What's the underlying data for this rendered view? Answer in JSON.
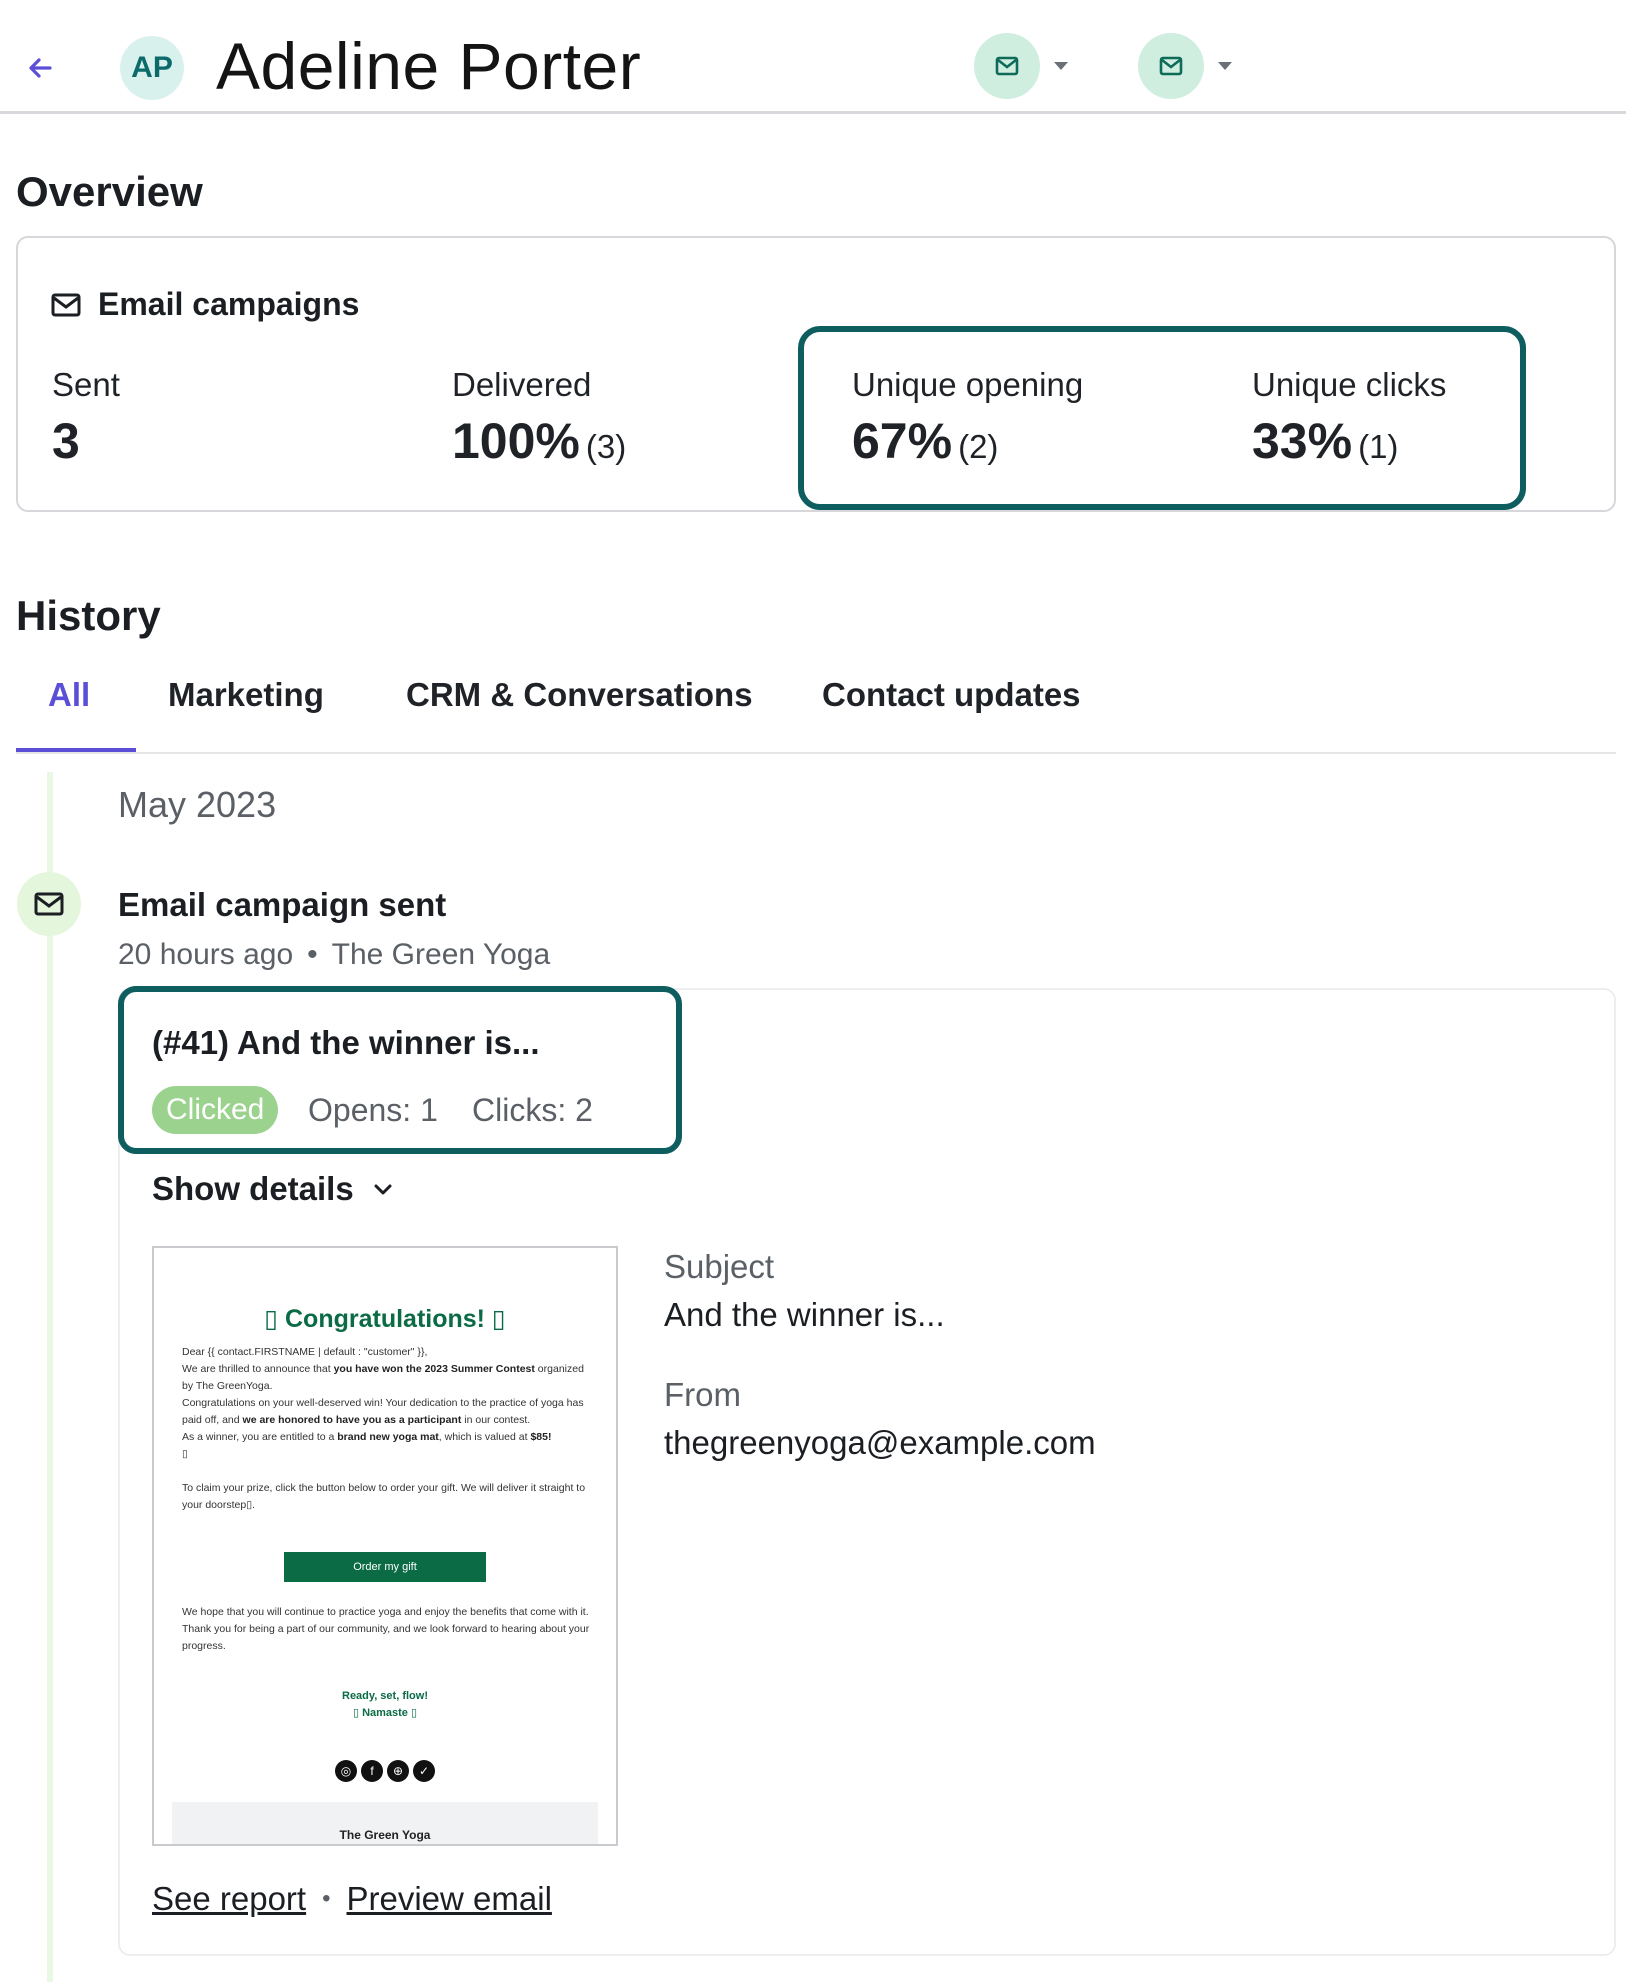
{
  "header": {
    "avatar_initials": "AP",
    "contact_name": "Adeline Porter"
  },
  "overview": {
    "title": "Overview",
    "campaigns_label": "Email campaigns",
    "stats": {
      "sent_label": "Sent",
      "sent_value": "3",
      "delivered_label": "Delivered",
      "delivered_value": "100%",
      "delivered_count": "(3)",
      "opening_label": "Unique opening",
      "opening_value": "67%",
      "opening_count": "(2)",
      "clicks_label": "Unique clicks",
      "clicks_value": "33%",
      "clicks_count": "(1)"
    }
  },
  "history": {
    "title": "History",
    "tabs": [
      {
        "label": "All"
      },
      {
        "label": "Marketing"
      },
      {
        "label": "CRM & Conversations"
      },
      {
        "label": "Contact updates"
      }
    ],
    "month": "May 2023",
    "event": {
      "title": "Email campaign sent",
      "time": "20 hours ago",
      "sender": "The Green Yoga",
      "campaign_name": "(#41) And the winner is...",
      "status": "Clicked",
      "opens": "Opens: 1",
      "clicks": "Clicks: 2",
      "show_details": "Show details",
      "subject_label": "Subject",
      "subject_value": "And the winner is...",
      "from_label": "From",
      "from_value": "thegreenyoga@example.com",
      "see_report": "See report",
      "preview_email": "Preview email"
    },
    "preview": {
      "heading": "▯ Congratulations! ▯",
      "line1": "Dear {{ contact.FIRSTNAME | default : \"customer\" }},",
      "line2a": "We are thrilled to announce that ",
      "line2b": "you have won the 2023 Summer Contest",
      "line2c": " organized by The GreenYoga.",
      "line3a": "Congratulations on your well-deserved win! Your dedication to the practice of yoga has paid off, and ",
      "line3b": "we are honored to have you as a participant",
      "line3c": " in our contest.",
      "line4a": "As a winner, you are entitled to a ",
      "line4b": "brand new yoga mat",
      "line4c": ", which is valued at ",
      "line4d": "$85!",
      "line4e": " ▯",
      "line5": "To claim your prize, click the button below to order your gift. We will deliver it straight to your doorstep▯.",
      "button": "Order my gift",
      "line6": "We hope that you will continue to practice yoga and enjoy the benefits that come with it. Thank you for being a part of our community, and we look forward to hearing about your progress.",
      "sign1": "Ready, set, flow!",
      "sign2": "▯ Namaste ▯",
      "footer": "The Green Yoga"
    }
  },
  "colors": {
    "accent": "#5a4fd6",
    "highlight": "#0e5d5f",
    "badge": "#9bd28e",
    "brand_green": "#0a6b45"
  },
  "icons": [
    "back-arrow-icon",
    "mail-icon",
    "chevron-down-icon",
    "instagram-icon",
    "facebook-icon",
    "globe-icon",
    "twitter-icon"
  ]
}
